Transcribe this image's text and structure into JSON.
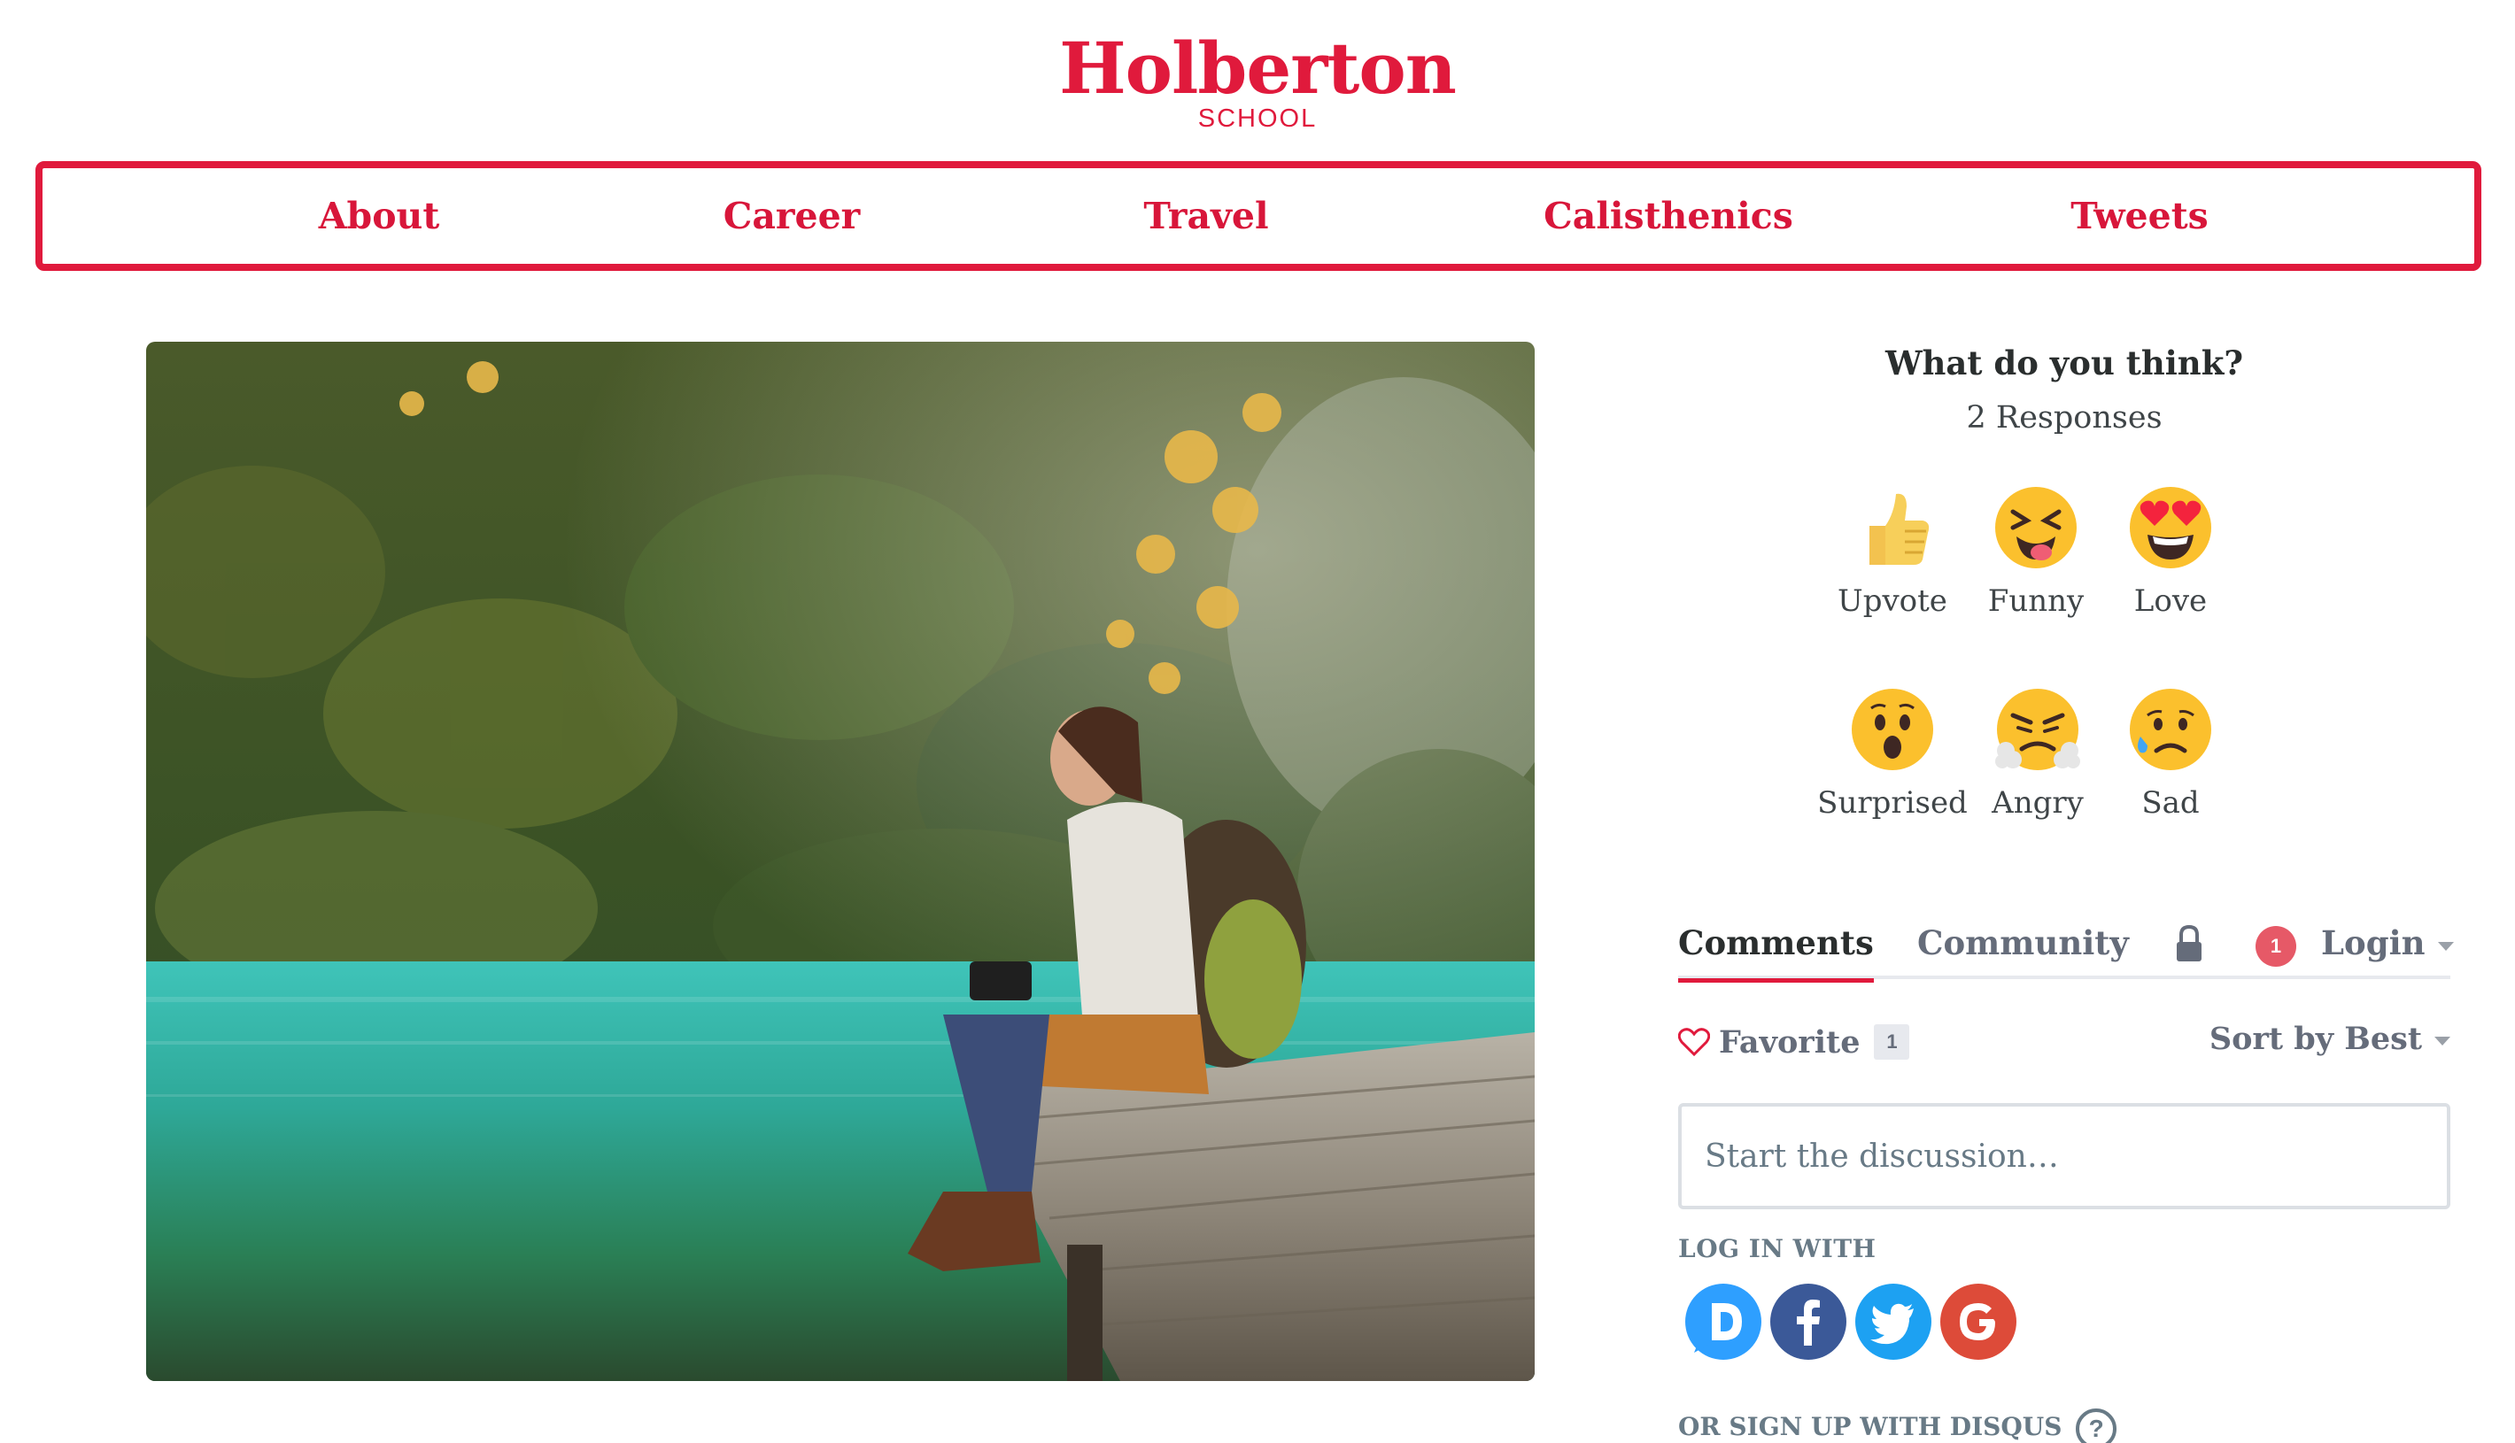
{
  "logo": {
    "main": "Holberton",
    "sub": "SCHOOL"
  },
  "nav": [
    {
      "label": "About"
    },
    {
      "label": "Career"
    },
    {
      "label": "Travel"
    },
    {
      "label": "Calisthenics"
    },
    {
      "label": "Tweets"
    }
  ],
  "photo": {
    "subject": "hiker-sitting-on-lake-pier"
  },
  "reactions": {
    "title": "What do you think?",
    "responses": "2 Responses",
    "items": [
      {
        "label": "Upvote",
        "icon": "thumbs-up-icon"
      },
      {
        "label": "Funny",
        "icon": "laughing-squint-icon"
      },
      {
        "label": "Love",
        "icon": "heart-eyes-icon"
      },
      {
        "label": "Surprised",
        "icon": "surprised-icon"
      },
      {
        "label": "Angry",
        "icon": "angry-icon"
      },
      {
        "label": "Sad",
        "icon": "sad-icon"
      }
    ]
  },
  "comments": {
    "tabs": {
      "comments": "Comments",
      "community": "Community"
    },
    "notification_count": "1",
    "login": "Login",
    "favorite": "Favorite",
    "favorite_count": "1",
    "sort": "Sort by Best",
    "placeholder": "Start the discussion…",
    "login_with": "LOG IN WITH",
    "signup": "OR SIGN UP WITH DISQUS",
    "help": "?"
  },
  "colors": {
    "brand": "#e01a3c",
    "facebook": "#3b5998",
    "twitter": "#1da1f2",
    "google": "#dd4b39",
    "disqus": "#2e9fff"
  }
}
